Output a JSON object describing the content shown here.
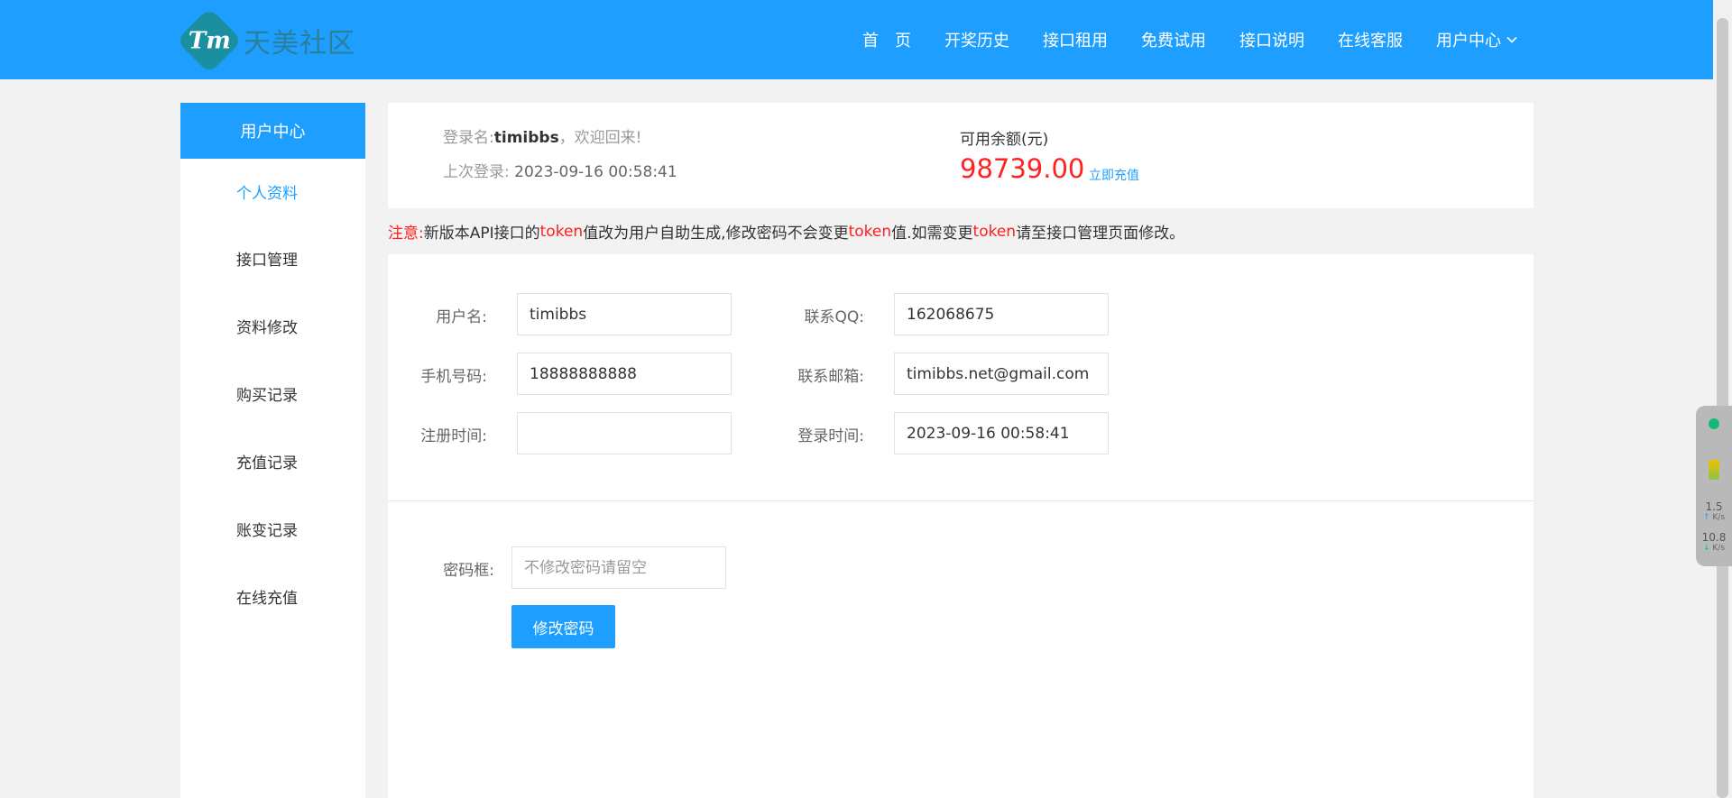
{
  "header": {
    "logo_mark": "Tm",
    "logo_text": "天美社区",
    "nav": [
      {
        "label": "首　页"
      },
      {
        "label": "开奖历史"
      },
      {
        "label": "接口租用"
      },
      {
        "label": "免费试用"
      },
      {
        "label": "接口说明"
      },
      {
        "label": "在线客服"
      },
      {
        "label": "用户中心"
      }
    ]
  },
  "sidebar": {
    "title": "用户中心",
    "items": [
      {
        "label": "个人资料",
        "active": true
      },
      {
        "label": "接口管理"
      },
      {
        "label": "资料修改"
      },
      {
        "label": "购买记录"
      },
      {
        "label": "充值记录"
      },
      {
        "label": "账变记录"
      },
      {
        "label": "在线充值"
      }
    ]
  },
  "info": {
    "login_prefix": "登录名:",
    "username": "timibbs",
    "welcome": "，欢迎回来!",
    "last_login_label": "上次登录:",
    "last_login_value": "2023-09-16 00:58:41",
    "balance_label": "可用余额(元)",
    "balance_value": "98739.00",
    "recharge_link": "立即充值"
  },
  "notice": {
    "prefix": "注意:",
    "p1": " 新版本API接口的",
    "t1": "token",
    "p2": "值改为用户自助生成,修改密码不会变更",
    "t2": "token",
    "p3": "值.如需变更",
    "t3": "token",
    "p4": "请至接口管理页面修改。"
  },
  "form": {
    "username_label": "用户名:",
    "username_value": "timibbs",
    "qq_label": "联系QQ:",
    "qq_value": "162068675",
    "phone_label": "手机号码:",
    "phone_value": "18888888888",
    "email_label": "联系邮箱:",
    "email_value": "timibbs.net@gmail.com",
    "reg_label": "注册时间:",
    "reg_value": "",
    "login_time_label": "登录时间:",
    "login_time_value": "2023-09-16 00:58:41",
    "password_label": "密码框:",
    "password_placeholder": "不修改密码请留空",
    "submit_label": "修改密码"
  },
  "widget": {
    "up_value": "1.5",
    "up_unit": "K/s",
    "down_value": "10.8",
    "down_unit": "K/s"
  },
  "colors": {
    "primary": "#1e9fff",
    "danger": "#ff1e1e"
  }
}
